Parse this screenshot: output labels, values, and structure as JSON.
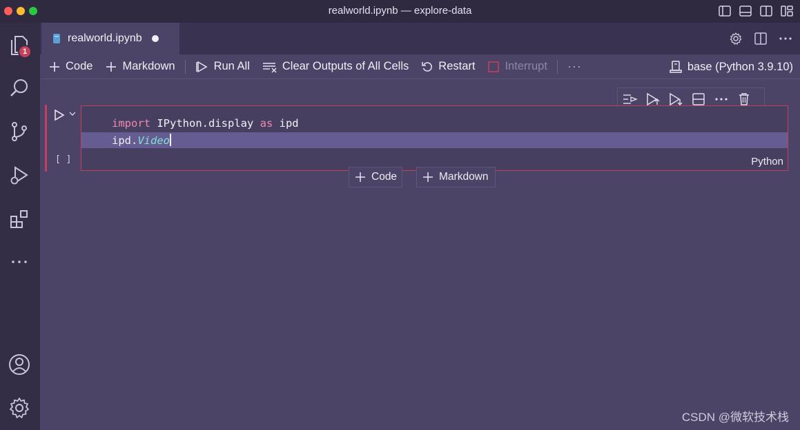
{
  "window": {
    "title": "realworld.ipynb — explore-data"
  },
  "activity_bar": {
    "explorer_badge": "1"
  },
  "tab": {
    "label": "realworld.ipynb"
  },
  "toolbar": {
    "code_label": "Code",
    "markdown_label": "Markdown",
    "run_all_label": "Run All",
    "clear_outputs_label": "Clear Outputs of All Cells",
    "restart_label": "Restart",
    "interrupt_label": "Interrupt",
    "more_label": "···",
    "kernel_label": "base (Python 3.9.10)"
  },
  "cell": {
    "exec_count": "[ ]",
    "line1": {
      "kw_import": "import",
      "module": " IPython.display ",
      "kw_as": "as",
      "alias": " ipd"
    },
    "line2": {
      "prefix": "ipd.",
      "class_name": "Video"
    },
    "language": "Python"
  },
  "add_cell": {
    "code_label": "Code",
    "markdown_label": "Markdown"
  },
  "watermark": "CSDN @微软技术栈",
  "colors": {
    "editor_bg": "#4b4466",
    "cell_border": "#c2405e",
    "line_highlight": "#655c92",
    "keyword": "#f08bb0",
    "class": "#7fe3d8"
  }
}
